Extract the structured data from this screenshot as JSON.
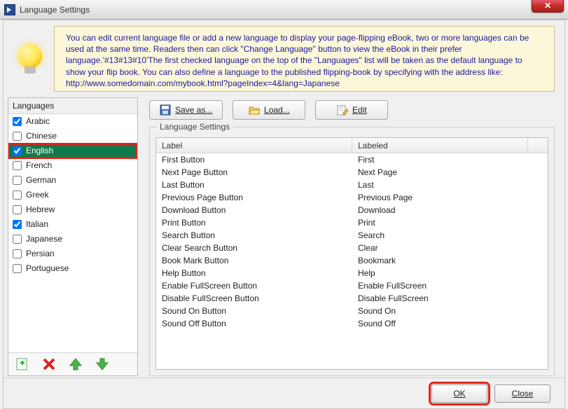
{
  "window": {
    "title": "Language Settings"
  },
  "banner": {
    "text": "You can edit current language file or add a new language to display your page-flipping eBook, two or more languages can be used at the same time. Readers then can click \"Change Language\" button to view the eBook in their prefer language.'#13#13#10'The first checked language on the top of the \"Languages\" list will be taken as the default language to show your flip book. You can also define a language to the published flipping-book by specifying with the address like: http://www.somedomain.com/mybook.html?pageIndex=4&lang=Japanese"
  },
  "sidebar": {
    "header": "Languages",
    "items": [
      {
        "label": "Arabic",
        "checked": true,
        "selected": false
      },
      {
        "label": "Chinese",
        "checked": false,
        "selected": false
      },
      {
        "label": "English",
        "checked": true,
        "selected": true
      },
      {
        "label": "French",
        "checked": false,
        "selected": false
      },
      {
        "label": "German",
        "checked": false,
        "selected": false
      },
      {
        "label": "Greek",
        "checked": false,
        "selected": false
      },
      {
        "label": "Hebrew",
        "checked": false,
        "selected": false
      },
      {
        "label": "Italian",
        "checked": true,
        "selected": false
      },
      {
        "label": "Japanese",
        "checked": false,
        "selected": false
      },
      {
        "label": "Persian",
        "checked": false,
        "selected": false
      },
      {
        "label": "Portuguese",
        "checked": false,
        "selected": false
      }
    ],
    "toolbar": {
      "add": "add-language-icon",
      "remove": "remove-language-icon",
      "up": "move-up-icon",
      "down": "move-down-icon"
    }
  },
  "buttons": {
    "save_as": "Save as...",
    "load": "Load...",
    "edit": "Edit"
  },
  "group": {
    "legend": "Language Settings",
    "columns": {
      "c1": "Label",
      "c2": "Labeled"
    },
    "rows": [
      {
        "label": "First Button",
        "labeled": "First"
      },
      {
        "label": "Next Page Button",
        "labeled": "Next Page"
      },
      {
        "label": "Last Button",
        "labeled": "Last"
      },
      {
        "label": "Previous Page Button",
        "labeled": "Previous Page"
      },
      {
        "label": "Download Button",
        "labeled": "Download"
      },
      {
        "label": "Print Button",
        "labeled": "Print"
      },
      {
        "label": "Search Button",
        "labeled": "Search"
      },
      {
        "label": "Clear Search Button",
        "labeled": "Clear"
      },
      {
        "label": "Book Mark Button",
        "labeled": "Bookmark"
      },
      {
        "label": "Help Button",
        "labeled": "Help"
      },
      {
        "label": "Enable FullScreen Button",
        "labeled": "Enable FullScreen"
      },
      {
        "label": "Disable FullScreen Button",
        "labeled": "Disable FullScreen"
      },
      {
        "label": "Sound On Button",
        "labeled": "Sound On"
      },
      {
        "label": "Sound Off Button",
        "labeled": "Sound Off"
      }
    ]
  },
  "footer": {
    "ok": "OK",
    "close": "Close"
  }
}
